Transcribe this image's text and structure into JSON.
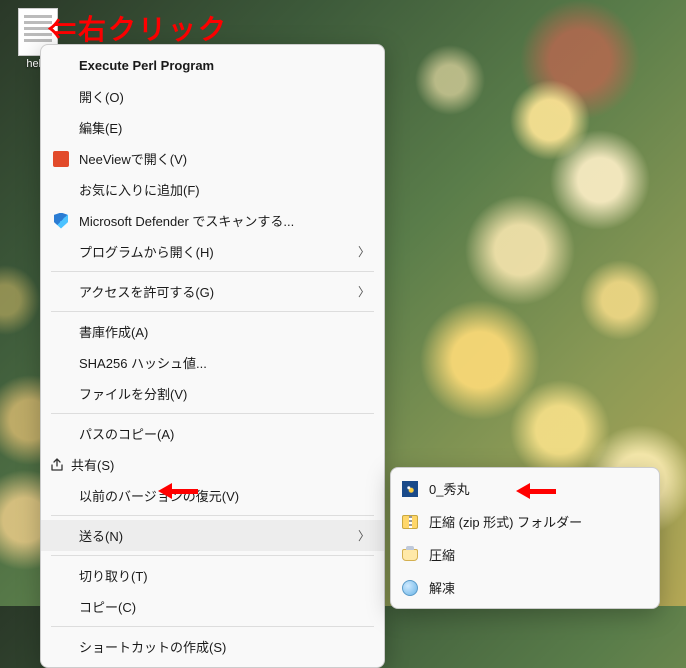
{
  "desktop": {
    "file_label": "hello"
  },
  "annotations": {
    "right_click_hint": "⇐右クリック"
  },
  "context_menu": {
    "execute_perl": "Execute Perl Program",
    "open": "開く(O)",
    "edit": "編集(E)",
    "neeview_open": "NeeViewで開く(V)",
    "add_favorite": "お気に入りに追加(F)",
    "defender_scan": "Microsoft Defender でスキャンする...",
    "open_with": "プログラムから開く(H)",
    "grant_access": "アクセスを許可する(G)",
    "create_archive": "書庫作成(A)",
    "sha256": "SHA256 ハッシュ値...",
    "split_file": "ファイルを分割(V)",
    "copy_path": "パスのコピー(A)",
    "share": "共有(S)",
    "restore_versions": "以前のバージョンの復元(V)",
    "send_to": "送る(N)",
    "cut": "切り取り(T)",
    "copy": "コピー(C)",
    "create_shortcut": "ショートカットの作成(S)"
  },
  "submenu": {
    "hidemaru": "0_秀丸",
    "zip_folder": "圧縮 (zip 形式) フォルダー",
    "compress": "圧縮",
    "decompress": "解凍"
  }
}
